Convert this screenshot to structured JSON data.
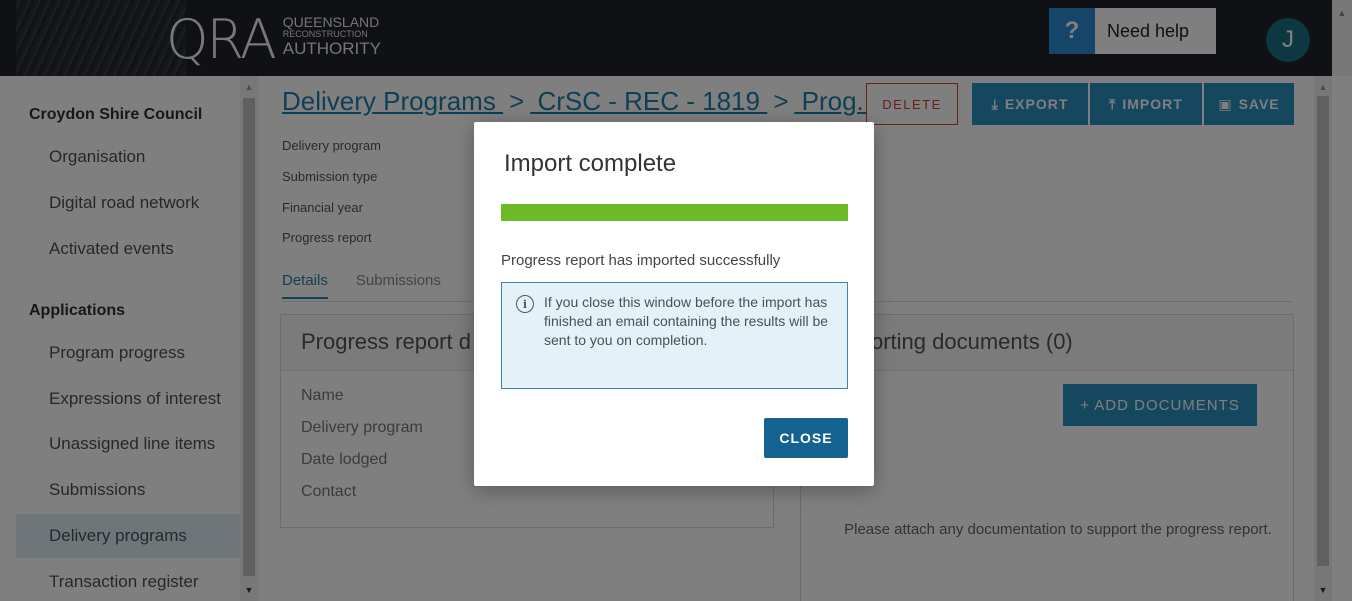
{
  "header": {
    "logo_main": "QRA",
    "logo_line1": "QUEENSLAND",
    "logo_line2": "RECONSTRUCTION",
    "logo_line3": "AUTHORITY",
    "help_icon": "?",
    "help_label": "Need help",
    "avatar_initial": "J"
  },
  "sidebar": {
    "org_heading": "Croydon Shire Council",
    "org_items": [
      {
        "label": "Organisation"
      },
      {
        "label": "Digital road network"
      },
      {
        "label": "Activated events"
      }
    ],
    "apps_heading": "Applications",
    "app_items": [
      {
        "label": "Program progress"
      },
      {
        "label": "Expressions of interest"
      },
      {
        "label": "Unassigned line items"
      },
      {
        "label": "Submissions"
      },
      {
        "label": "Delivery programs",
        "active": true
      },
      {
        "label": "Transaction register"
      }
    ]
  },
  "main": {
    "breadcrumb": [
      {
        "label": "Delivery Programs "
      },
      {
        "label": " CrSC - REC - 1819 "
      },
      {
        "label": " Prog..."
      }
    ],
    "breadcrumb_sep": ">",
    "buttons": {
      "delete": "DELETE",
      "export": "EXPORT",
      "import": "IMPORT",
      "save": "SAVE"
    },
    "meta_labels": [
      "Delivery program",
      "Submission type",
      "Financial year",
      "Progress report"
    ],
    "tabs": [
      {
        "label": "Details",
        "active": true
      },
      {
        "label": "Submissions"
      }
    ],
    "details_panel": {
      "title": "Progress report d",
      "fields": [
        "Name",
        "Delivery program",
        "Date lodged",
        "Contact"
      ]
    },
    "docs_panel": {
      "title": "orting documents (0)",
      "add_button": "+ ADD DOCUMENTS",
      "empty_text": "Please attach any documentation to support the progress report."
    }
  },
  "modal": {
    "title": "Import complete",
    "progress_fraction": 1.0,
    "progress_color": "#6bbb27",
    "message": "Progress report has imported successfully",
    "info_icon": "info-icon",
    "info_text": "If you close this window before the import has finished an email containing the results will be sent to you on completion.",
    "close_label": "CLOSE"
  },
  "colors": {
    "accent": "#2b8fbd",
    "link": "#1d7fa8",
    "danger": "#d2402e",
    "header_bg": "#1f2328",
    "modal_button": "#14628f"
  }
}
